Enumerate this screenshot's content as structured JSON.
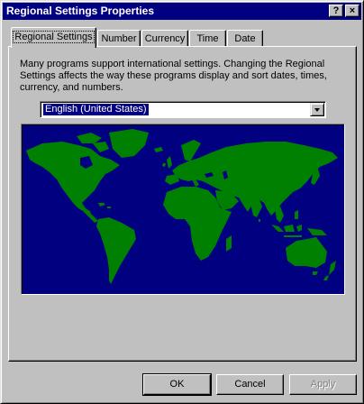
{
  "window": {
    "title": "Regional Settings Properties",
    "help_label": "?",
    "close_label": "×"
  },
  "tabs": [
    {
      "label": "Regional Settings",
      "active": true
    },
    {
      "label": "Number",
      "active": false
    },
    {
      "label": "Currency",
      "active": false
    },
    {
      "label": "Time",
      "active": false
    },
    {
      "label": "Date",
      "active": false
    }
  ],
  "panel": {
    "description": "Many programs support international settings. Changing the Regional Settings affects the way these programs display and sort dates, times, currency, and numbers.",
    "locale_selected": "English (United States)"
  },
  "buttons": {
    "ok": "OK",
    "cancel": "Cancel",
    "apply": "Apply"
  },
  "colors": {
    "title_bar": "#000080",
    "map_ocean": "#000080",
    "map_land": "#008000",
    "face": "#c0c0c0"
  },
  "icons": {
    "map": "world-map-icon",
    "dropdown": "chevron-down-icon"
  }
}
